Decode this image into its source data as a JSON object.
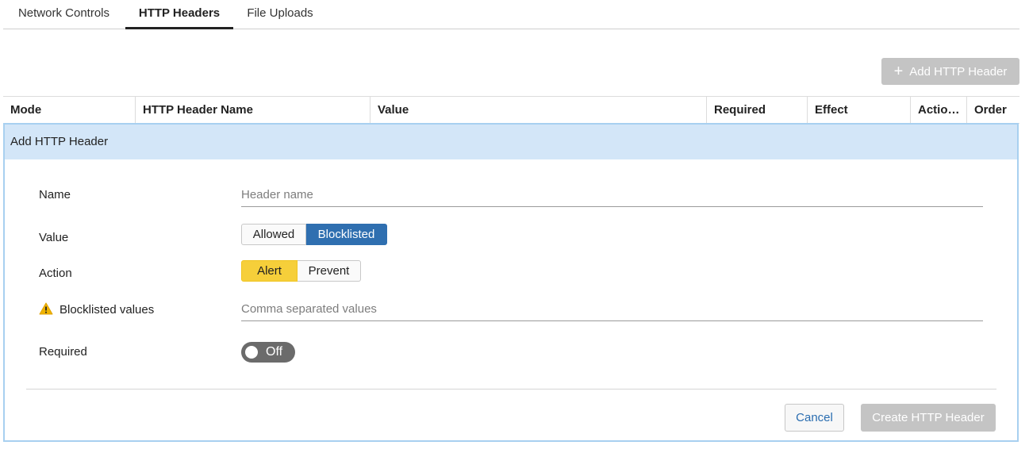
{
  "tabs": [
    "Network Controls",
    "HTTP Headers",
    "File Uploads"
  ],
  "active_tab": "HTTP Headers",
  "toolbar": {
    "add_label": "Add HTTP Header",
    "add_icon": "plus-icon"
  },
  "table": {
    "columns": [
      "Mode",
      "HTTP Header Name",
      "Value",
      "Required",
      "Effect",
      "Actio…",
      "Order"
    ]
  },
  "form": {
    "title": "Add HTTP Header",
    "name_label": "Name",
    "name_placeholder": "Header name",
    "name_value": "",
    "value_label": "Value",
    "value_options": [
      "Allowed",
      "Blocklisted"
    ],
    "value_selected": "Blocklisted",
    "action_label": "Action",
    "action_options": [
      "Alert",
      "Prevent"
    ],
    "action_selected": "Alert",
    "blocklisted_label": "Blocklisted values",
    "blocklisted_icon": "warning-icon",
    "blocklisted_placeholder": "Comma separated values",
    "blocklisted_value": "",
    "required_label": "Required",
    "required_toggle": "Off",
    "cancel_label": "Cancel",
    "create_label": "Create HTTP Header"
  },
  "colors": {
    "selected_blue": "#2f6fb0",
    "selected_yellow": "#f6cf3a",
    "panel_header_bg": "#d3e6f8",
    "panel_border": "#a8d0f0",
    "disabled_button": "#c4c4c4"
  }
}
